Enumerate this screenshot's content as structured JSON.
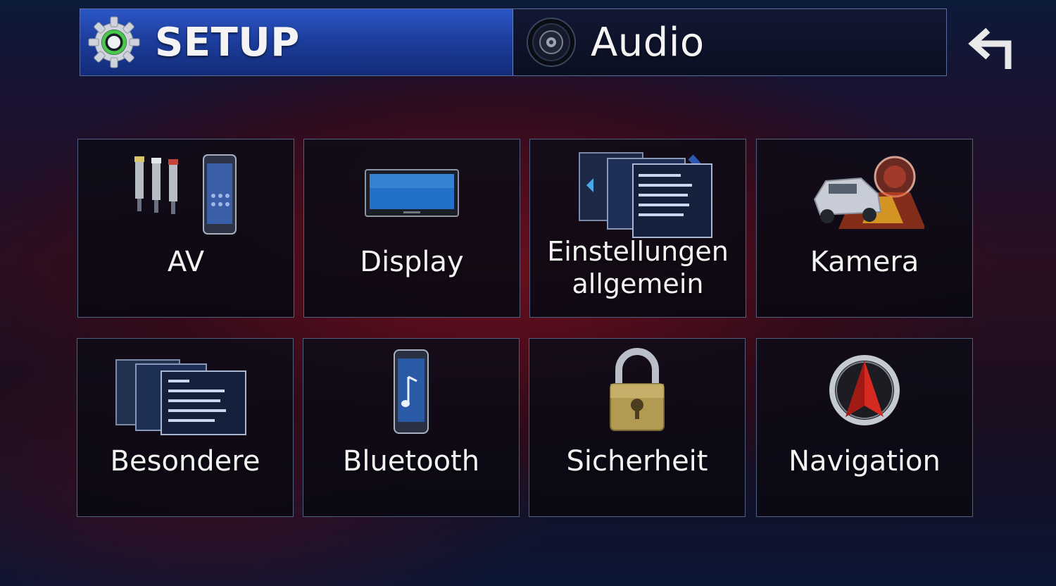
{
  "header": {
    "tabs": [
      {
        "label": "SETUP",
        "icon": "gear-icon",
        "active": true
      },
      {
        "label": "Audio",
        "icon": "speaker-icon",
        "active": false
      }
    ],
    "back_icon": "back-arrow-icon"
  },
  "menu": {
    "tiles": [
      {
        "label": "AV",
        "icon": "av-cables-phone-icon"
      },
      {
        "label": "Display",
        "icon": "display-monitor-icon"
      },
      {
        "label": "Einstellungen\nallgemein",
        "icon": "general-settings-screens-icon"
      },
      {
        "label": "Kamera",
        "icon": "rear-camera-car-icon"
      },
      {
        "label": "Besondere",
        "icon": "special-screens-icon"
      },
      {
        "label": "Bluetooth",
        "icon": "bluetooth-phone-icon"
      },
      {
        "label": "Sicherheit",
        "icon": "padlock-icon"
      },
      {
        "label": "Navigation",
        "icon": "navigation-compass-icon"
      }
    ]
  },
  "colors": {
    "active_tab": "#1d3e9e",
    "tile_border": "#51607f",
    "background_red": "#780e1c",
    "background_blue": "#0c1a3a"
  }
}
